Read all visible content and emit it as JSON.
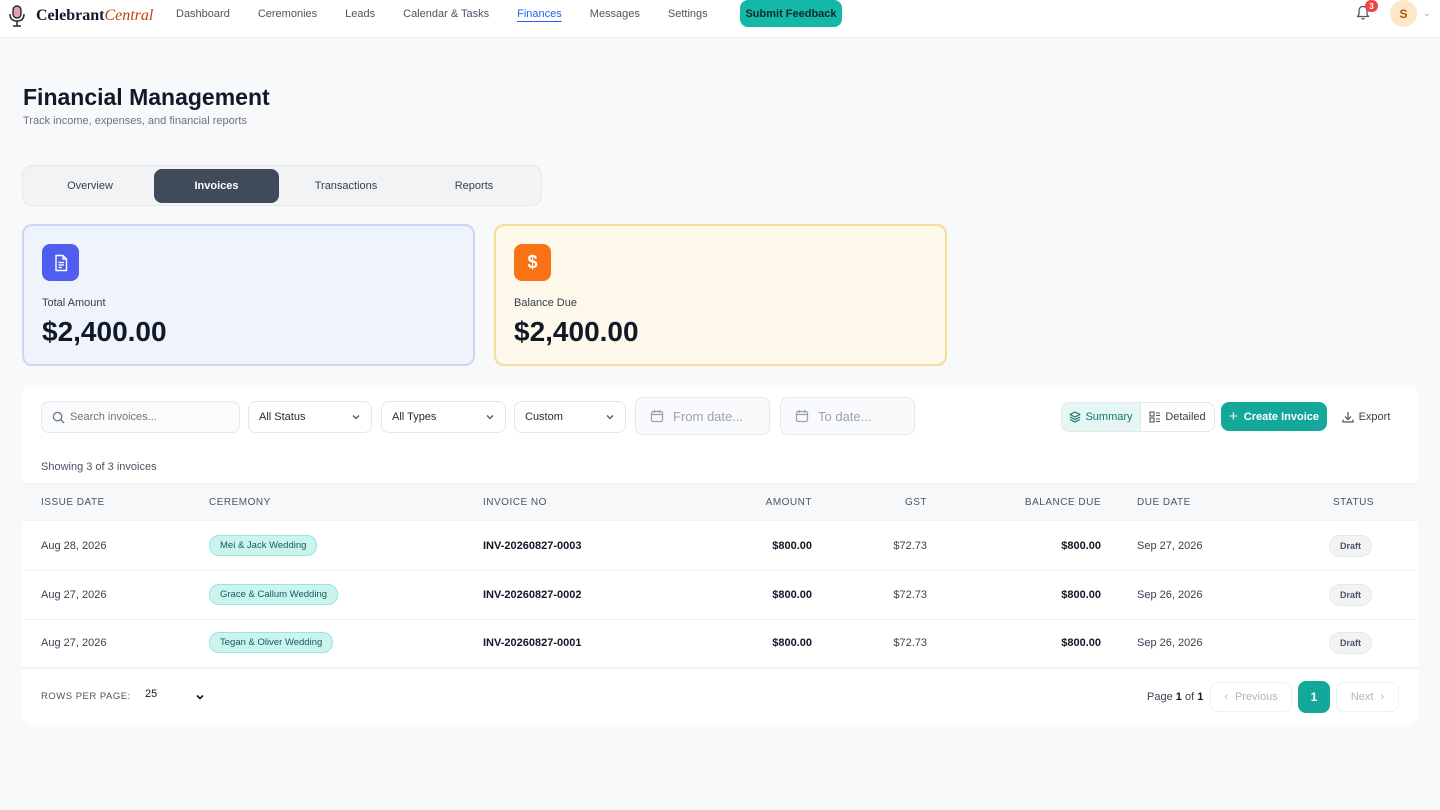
{
  "app": {
    "logo_main": "Celebrant",
    "logo_accent": "Central"
  },
  "nav": {
    "items": [
      {
        "label": "Dashboard"
      },
      {
        "label": "Ceremonies"
      },
      {
        "label": "Leads"
      },
      {
        "label": "Calendar & Tasks"
      },
      {
        "label": "Finances",
        "active": true
      },
      {
        "label": "Messages"
      },
      {
        "label": "Settings"
      }
    ],
    "feedback_label": "Submit Feedback",
    "notification_count": "3",
    "avatar_initial": "S"
  },
  "header": {
    "title": "Financial Management",
    "subtitle": "Track income, expenses, and financial reports"
  },
  "tabs": [
    {
      "label": "Overview"
    },
    {
      "label": "Invoices",
      "active": true
    },
    {
      "label": "Transactions"
    },
    {
      "label": "Reports"
    }
  ],
  "stats": {
    "total": {
      "label": "Total Amount",
      "value": "$2,400.00",
      "icon": "document-icon"
    },
    "balance": {
      "label": "Balance Due",
      "value": "$2,400.00",
      "icon": "dollar-icon",
      "icon_glyph": "$"
    }
  },
  "filters": {
    "search_placeholder": "Search invoices...",
    "status": "All Status",
    "type": "All Types",
    "period": "Custom",
    "from_placeholder": "From date...",
    "to_placeholder": "To date...",
    "view_summary": "Summary",
    "view_detailed": "Detailed",
    "create_label": "Create Invoice",
    "export_label": "Export"
  },
  "table": {
    "showing": "Showing 3 of 3 invoices",
    "columns": {
      "issue_date": "ISSUE DATE",
      "ceremony": "CEREMONY",
      "invoice_no": "INVOICE NO",
      "amount": "AMOUNT",
      "gst": "GST",
      "balance_due": "BALANCE DUE",
      "due_date": "DUE DATE",
      "status": "STATUS"
    },
    "rows": [
      {
        "issue_date": "Aug 28, 2026",
        "ceremony": "Mei & Jack Wedding",
        "invoice_no": "INV-20260827-0003",
        "amount": "$800.00",
        "gst": "$72.73",
        "balance_due": "$800.00",
        "due_date": "Sep 27, 2026",
        "status": "Draft"
      },
      {
        "issue_date": "Aug 27, 2026",
        "ceremony": "Grace & Callum Wedding",
        "invoice_no": "INV-20260827-0002",
        "amount": "$800.00",
        "gst": "$72.73",
        "balance_due": "$800.00",
        "due_date": "Sep 26, 2026",
        "status": "Draft"
      },
      {
        "issue_date": "Aug 27, 2026",
        "ceremony": "Tegan & Oliver Wedding",
        "invoice_no": "INV-20260827-0001",
        "amount": "$800.00",
        "gst": "$72.73",
        "balance_due": "$800.00",
        "due_date": "Sep 26, 2026",
        "status": "Draft"
      }
    ]
  },
  "pagination": {
    "rows_label": "ROWS PER PAGE:",
    "rows_value": "25",
    "page_prefix": "Page",
    "current": "1",
    "of_word": "of",
    "total": "1",
    "prev_label": "Previous",
    "next_label": "Next"
  }
}
